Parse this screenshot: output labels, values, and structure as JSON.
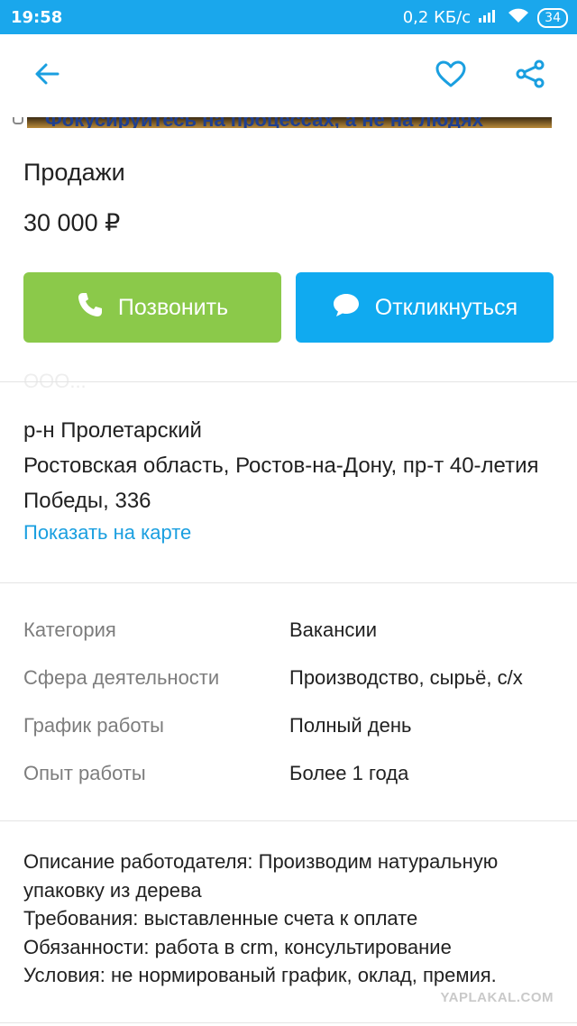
{
  "status_bar": {
    "time": "19:58",
    "network_speed": "0,2 КБ/с",
    "battery": "34"
  },
  "app_bar": {
    "back_icon": "arrow-left-icon",
    "favorite_icon": "heart-outline-icon",
    "share_icon": "share-icon",
    "accent_color": "#1a9fe0"
  },
  "banner": {
    "partial_text": "Фокусируйтесь на процессах, а не на людях"
  },
  "listing": {
    "title": "Продажи",
    "price": "30 000 ₽"
  },
  "actions": {
    "call_label": "Позвонить",
    "call_icon": "phone-icon",
    "call_color": "#8bc94a",
    "reply_label": "Откликнуться",
    "reply_icon": "chat-bubble-icon",
    "reply_color": "#10aaf0"
  },
  "faded_text": "ООО...",
  "location": {
    "district": "р-н Пролетарский",
    "address": "Ростовская область, Ростов-на-Дону, пр-т 40-летия Победы, 336",
    "map_link": "Показать на карте"
  },
  "params": [
    {
      "key": "Категория",
      "value": "Вакансии"
    },
    {
      "key": "Сфера деятельности",
      "value": "Производство, сырьё, с/х"
    },
    {
      "key": "График работы",
      "value": "Полный день"
    },
    {
      "key": "Опыт работы",
      "value": "Более 1 года"
    }
  ],
  "description": {
    "line1": "Описание работодателя: Производим натуральную упаковку из дерева",
    "line2": "Требования: выставленные счета к оплате",
    "line3": "Обязанности: работа в crm, консультирование",
    "line4": "Условия: не нормированый график, оклад, премия."
  },
  "watermark": "YAPLAKAL.COM"
}
